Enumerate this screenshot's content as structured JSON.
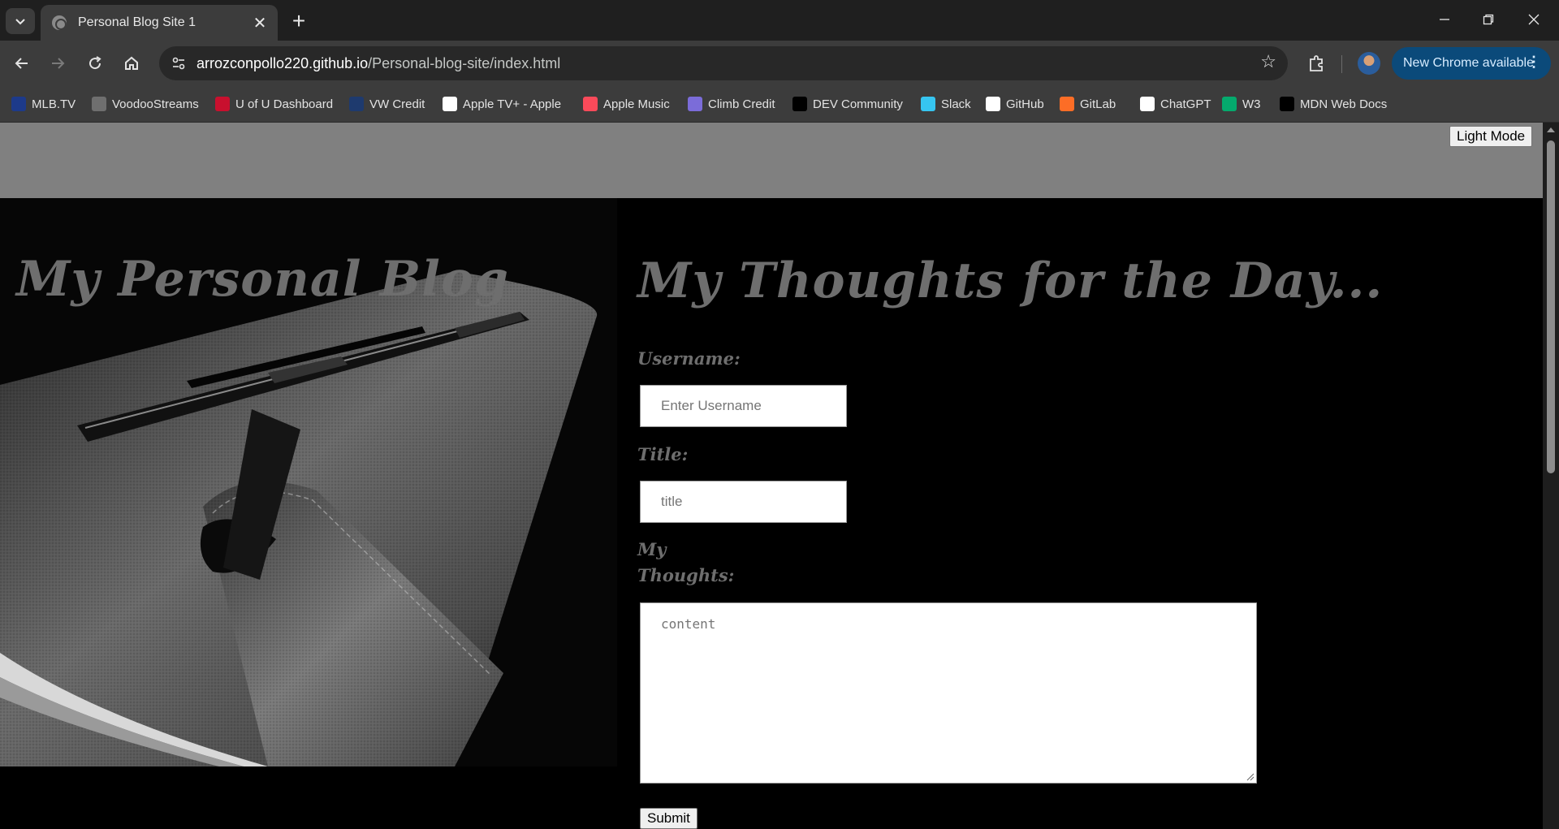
{
  "browser": {
    "tab_title": "Personal Blog Site 1",
    "url_host": "arrozconpollo220.github.io",
    "url_path": "/Personal-blog-site/index.html",
    "update_label": "New Chrome available",
    "bookmarks": [
      {
        "label": "MLB.TV",
        "icon": "mlb-icon",
        "color": "#1d3a8a"
      },
      {
        "label": "VoodooStreams",
        "icon": "globe-icon",
        "color": "#6f6f6f"
      },
      {
        "label": "U of U Dashboard",
        "icon": "utah-icon",
        "color": "#c8102e"
      },
      {
        "label": "VW Credit",
        "icon": "vw-icon",
        "color": "#1e3a6e"
      },
      {
        "label": "Apple TV+ - Apple",
        "icon": "apple-icon",
        "color": "#ffffff"
      },
      {
        "label": "Apple Music",
        "icon": "music-icon",
        "color": "#fa4a5a"
      },
      {
        "label": "Climb Credit",
        "icon": "climb-icon",
        "color": "#7b6cd9"
      },
      {
        "label": "DEV Community",
        "icon": "dev-icon",
        "color": "#000000"
      },
      {
        "label": "Slack",
        "icon": "slack-icon",
        "color": "#36c5f0"
      },
      {
        "label": "GitHub",
        "icon": "github-icon",
        "color": "#ffffff"
      },
      {
        "label": "GitLab",
        "icon": "gitlab-icon",
        "color": "#fc6d26"
      },
      {
        "label": "ChatGPT",
        "icon": "chatgpt-icon",
        "color": "#ffffff"
      },
      {
        "label": "W3",
        "icon": "w3-icon",
        "color": "#04aa6d"
      },
      {
        "label": "MDN Web Docs",
        "icon": "mdn-icon",
        "color": "#000000"
      }
    ]
  },
  "page": {
    "mode_button": "Light Mode",
    "blog_title": "My Personal Blog",
    "form_title": "My Thoughts for the Day...",
    "username_label": "Username:",
    "username_placeholder": "Enter Username",
    "title_label": "Title:",
    "title_placeholder": "title",
    "thoughts_label_1": "My",
    "thoughts_label_2": "Thoughts:",
    "content_placeholder": "content",
    "submit_label": "Submit"
  }
}
